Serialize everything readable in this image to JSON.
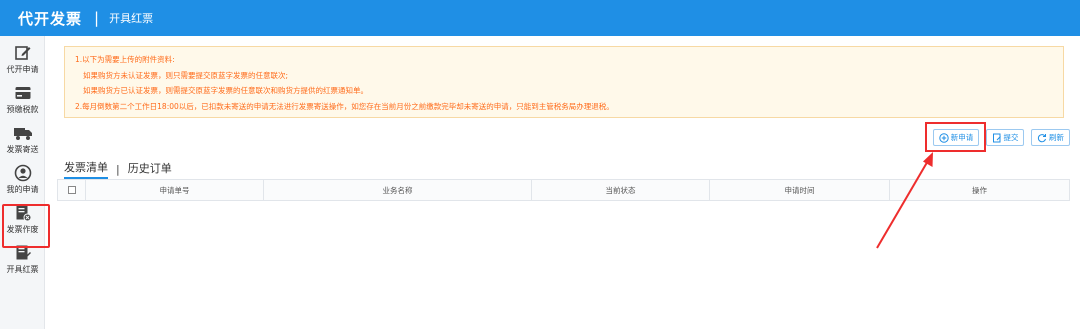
{
  "header": {
    "title": "代开发票",
    "separator": "|",
    "subtitle": "开具红票"
  },
  "sidebar": {
    "items": [
      {
        "label": "代开申请",
        "icon": "edit-icon"
      },
      {
        "label": "预缴税款",
        "icon": "card-icon"
      },
      {
        "label": "发票寄送",
        "icon": "truck-icon"
      },
      {
        "label": "我的申请",
        "icon": "user-icon"
      },
      {
        "label": "发票作废",
        "icon": "invoice-void-icon"
      },
      {
        "label": "开具红票",
        "icon": "red-invoice-icon"
      }
    ],
    "active": "开具红票"
  },
  "notice": {
    "line1": "1.以下为需要上传的附件资料:",
    "line2": "如果购货方未认证发票，则只需要提交原蓝字发票的任意联次;",
    "line3": "如果购货方已认证发票，则需提交原蓝字发票的任意联次和购货方提供的红票通知单。",
    "line4": "2.每月倒数第二个工作日18:00以后，已扣款未寄送的申请无法进行发票寄送操作，如您存在当前月份之前缴款完毕却未寄送的申请，只能到主管税务局办理退税。"
  },
  "toolbar": {
    "new_label": "新申请",
    "submit_label": "提交",
    "refresh_label": "刷新"
  },
  "tabs": [
    {
      "label": "发票清单"
    },
    {
      "label": "历史订单"
    }
  ],
  "tab_separator": "|",
  "table": {
    "columns": [
      "申请单号",
      "业务名称",
      "当前状态",
      "申请时间",
      "操作"
    ],
    "rows": []
  },
  "colors": {
    "brand": "#1f8fe5",
    "highlight": "#ee2d2d",
    "notice_text": "#ff6b1a",
    "notice_bg": "#fff9ea"
  }
}
